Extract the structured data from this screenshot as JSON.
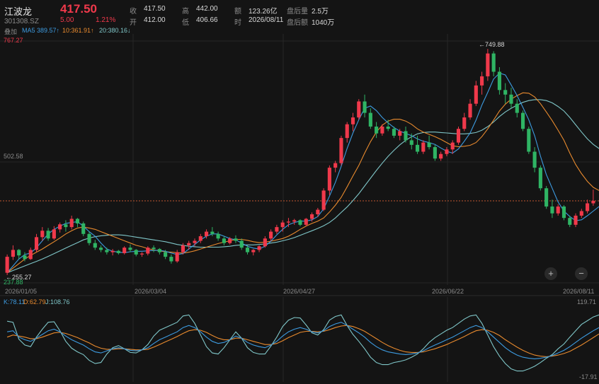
{
  "header": {
    "name": "江波龙",
    "code": "301308.SZ",
    "price": "417.50",
    "change": "5.00",
    "change_pct": "1.21%",
    "quote": [
      {
        "label": "收",
        "value": "417.50"
      },
      {
        "label": "开",
        "value": "412.00"
      },
      {
        "label": "高",
        "value": "442.00"
      },
      {
        "label": "低",
        "value": "406.66"
      },
      {
        "label": "额",
        "value": "123.26亿"
      },
      {
        "label": "时",
        "value": "2026/08/11"
      },
      {
        "label": "盘后量",
        "value": "2.5万"
      },
      {
        "label": "盘后额",
        "value": "1040万"
      }
    ]
  },
  "ma_legend": {
    "overlay": "叠加",
    "ma5": "MA5 389.57↑",
    "ma10": "10:361.91↑",
    "ma20": "20:380.16↓"
  },
  "kdj_legend": {
    "k": "K:78.11",
    "d": "D:62.79",
    "j": "J:108.76"
  },
  "colors": {
    "up": "#f0394b",
    "down": "#2fb464",
    "ma5": "#3d9be0",
    "ma10": "#e88a2e",
    "ma20": "#7fc6c8",
    "bg": "#141414"
  },
  "zoom": {
    "in": "+",
    "out": "−"
  },
  "chart_data": {
    "type": "candlestick",
    "price_axis": {
      "top_label": "767.27",
      "mid_label": "502.58",
      "bottom_label": "237.88",
      "range": [
        237.88,
        767.27
      ]
    },
    "x_ticks": [
      "2026/01/05",
      "2026/03/04",
      "2026/04/27",
      "2026/06/22",
      "2026/08/11"
    ],
    "annotations": {
      "high": "←749.88",
      "low": "←255.27"
    },
    "last_close": 417.5,
    "ohlc": [
      [
        260,
        300,
        255,
        295
      ],
      [
        295,
        320,
        288,
        310
      ],
      [
        310,
        312,
        290,
        298
      ],
      [
        298,
        305,
        285,
        290
      ],
      [
        290,
        315,
        288,
        310
      ],
      [
        310,
        345,
        305,
        338
      ],
      [
        338,
        360,
        330,
        352
      ],
      [
        352,
        358,
        330,
        335
      ],
      [
        335,
        362,
        332,
        355
      ],
      [
        355,
        370,
        348,
        366
      ],
      [
        366,
        375,
        350,
        360
      ],
      [
        360,
        385,
        355,
        378
      ],
      [
        378,
        380,
        360,
        368
      ],
      [
        368,
        372,
        340,
        345
      ],
      [
        345,
        350,
        320,
        325
      ],
      [
        325,
        332,
        310,
        315
      ],
      [
        315,
        320,
        305,
        310
      ],
      [
        310,
        315,
        300,
        305
      ],
      [
        305,
        312,
        298,
        308
      ],
      [
        308,
        310,
        300,
        303
      ],
      [
        303,
        318,
        300,
        315
      ],
      [
        315,
        322,
        305,
        310
      ],
      [
        310,
        312,
        296,
        300
      ],
      [
        300,
        305,
        295,
        302
      ],
      [
        302,
        318,
        298,
        315
      ],
      [
        315,
        320,
        305,
        312
      ],
      [
        312,
        314,
        300,
        305
      ],
      [
        305,
        310,
        290,
        295
      ],
      [
        295,
        300,
        280,
        285
      ],
      [
        285,
        310,
        282,
        305
      ],
      [
        305,
        325,
        300,
        320
      ],
      [
        320,
        330,
        310,
        325
      ],
      [
        325,
        335,
        318,
        330
      ],
      [
        330,
        345,
        325,
        340
      ],
      [
        340,
        355,
        335,
        350
      ],
      [
        350,
        360,
        340,
        345
      ],
      [
        345,
        350,
        330,
        335
      ],
      [
        335,
        340,
        320,
        325
      ],
      [
        325,
        338,
        322,
        335
      ],
      [
        335,
        342,
        325,
        330
      ],
      [
        330,
        335,
        310,
        315
      ],
      [
        315,
        320,
        300,
        305
      ],
      [
        305,
        312,
        298,
        310
      ],
      [
        310,
        320,
        305,
        318
      ],
      [
        318,
        340,
        315,
        335
      ],
      [
        335,
        355,
        330,
        350
      ],
      [
        350,
        365,
        345,
        360
      ],
      [
        360,
        375,
        350,
        370
      ],
      [
        370,
        380,
        360,
        372
      ],
      [
        372,
        378,
        365,
        375
      ],
      [
        375,
        377,
        362,
        365
      ],
      [
        365,
        380,
        362,
        378
      ],
      [
        378,
        392,
        372,
        388
      ],
      [
        388,
        402,
        382,
        398
      ],
      [
        398,
        445,
        395,
        440
      ],
      [
        440,
        495,
        430,
        490
      ],
      [
        490,
        505,
        480,
        500
      ],
      [
        500,
        560,
        495,
        555
      ],
      [
        555,
        590,
        545,
        585
      ],
      [
        585,
        610,
        570,
        600
      ],
      [
        600,
        640,
        595,
        635
      ],
      [
        635,
        650,
        600,
        610
      ],
      [
        610,
        620,
        575,
        580
      ],
      [
        580,
        590,
        555,
        565
      ],
      [
        565,
        585,
        560,
        580
      ],
      [
        580,
        595,
        570,
        575
      ],
      [
        575,
        580,
        555,
        560
      ],
      [
        560,
        575,
        550,
        570
      ],
      [
        570,
        580,
        545,
        550
      ],
      [
        550,
        565,
        530,
        540
      ],
      [
        540,
        560,
        520,
        525
      ],
      [
        525,
        550,
        520,
        545
      ],
      [
        545,
        560,
        530,
        535
      ],
      [
        535,
        540,
        505,
        510
      ],
      [
        510,
        525,
        505,
        520
      ],
      [
        520,
        535,
        515,
        530
      ],
      [
        530,
        550,
        520,
        545
      ],
      [
        545,
        580,
        540,
        575
      ],
      [
        575,
        610,
        570,
        600
      ],
      [
        600,
        640,
        595,
        630
      ],
      [
        630,
        680,
        625,
        670
      ],
      [
        670,
        700,
        650,
        690
      ],
      [
        690,
        750,
        680,
        740
      ],
      [
        740,
        745,
        690,
        700
      ],
      [
        700,
        710,
        650,
        660
      ],
      [
        660,
        675,
        630,
        650
      ],
      [
        650,
        665,
        620,
        630
      ],
      [
        630,
        640,
        600,
        610
      ],
      [
        610,
        615,
        570,
        575
      ],
      [
        575,
        580,
        520,
        525
      ],
      [
        525,
        535,
        480,
        490
      ],
      [
        490,
        495,
        440,
        445
      ],
      [
        445,
        450,
        400,
        405
      ],
      [
        405,
        420,
        380,
        390
      ],
      [
        390,
        410,
        385,
        405
      ],
      [
        405,
        408,
        375,
        380
      ],
      [
        380,
        385,
        360,
        365
      ],
      [
        365,
        390,
        360,
        385
      ],
      [
        385,
        400,
        380,
        395
      ],
      [
        395,
        420,
        390,
        412
      ],
      [
        412,
        442,
        406.66,
        417.5
      ]
    ],
    "ma5": [
      260,
      275,
      290,
      300,
      303,
      315,
      330,
      345,
      355,
      362,
      368,
      370,
      372,
      362,
      350,
      340,
      325,
      312,
      307,
      305,
      304,
      306,
      307,
      307,
      308,
      309,
      309,
      307,
      303,
      300,
      302,
      312,
      322,
      332,
      340,
      345,
      345,
      340,
      335,
      332,
      325,
      318,
      314,
      312,
      318,
      329,
      343,
      355,
      365,
      370,
      373,
      373,
      376,
      383,
      400,
      428,
      458,
      493,
      532,
      566,
      595,
      620,
      625,
      615,
      600,
      588,
      578,
      570,
      565,
      560,
      553,
      548,
      545,
      541,
      533,
      526,
      522,
      531,
      548,
      566,
      594,
      627,
      655,
      684,
      697,
      693,
      671,
      648,
      622,
      595,
      560,
      515,
      475,
      445,
      415,
      395,
      383,
      374,
      376,
      385,
      395,
      405
    ],
    "ma10": [
      260,
      270,
      280,
      290,
      298,
      305,
      312,
      320,
      328,
      336,
      345,
      352,
      358,
      360,
      358,
      355,
      350,
      345,
      340,
      335,
      330,
      325,
      320,
      317,
      313,
      310,
      308,
      306,
      305,
      304,
      303,
      305,
      308,
      312,
      316,
      320,
      324,
      327,
      330,
      333,
      333,
      331,
      328,
      326,
      327,
      329,
      332,
      335,
      340,
      347,
      355,
      362,
      368,
      373,
      380,
      393,
      408,
      425,
      448,
      472,
      495,
      522,
      547,
      568,
      583,
      592,
      596,
      596,
      592,
      585,
      575,
      568,
      563,
      558,
      552,
      545,
      538,
      536,
      537,
      539,
      545,
      558,
      575,
      594,
      614,
      629,
      640,
      648,
      654,
      653,
      645,
      630,
      612,
      593,
      572,
      550,
      522,
      497,
      477,
      460,
      447,
      440
    ],
    "ma20": [
      260,
      265,
      270,
      275,
      280,
      285,
      290,
      296,
      302,
      308,
      314,
      320,
      326,
      332,
      336,
      339,
      341,
      342,
      343,
      343,
      342,
      340,
      338,
      336,
      334,
      332,
      330,
      328,
      325,
      322,
      320,
      318,
      317,
      316,
      316,
      316,
      316,
      317,
      318,
      320,
      321,
      321,
      321,
      322,
      323,
      325,
      327,
      330,
      333,
      337,
      342,
      347,
      352,
      357,
      363,
      370,
      380,
      392,
      404,
      418,
      433,
      450,
      467,
      484,
      500,
      515,
      528,
      540,
      550,
      558,
      564,
      567,
      568,
      568,
      567,
      566,
      565,
      564,
      564,
      565,
      567,
      572,
      580,
      590,
      602,
      612,
      620,
      627,
      633,
      637,
      639,
      639,
      637,
      632,
      624,
      614,
      600,
      584,
      568,
      553,
      541,
      532
    ],
    "kdj": {
      "axis_top": "119.71",
      "axis_bottom": "-17.91",
      "range": [
        -17.91,
        119.71
      ],
      "k": [
        70,
        72,
        60,
        55,
        52,
        58,
        65,
        72,
        75,
        70,
        62,
        55,
        50,
        45,
        38,
        32,
        30,
        34,
        38,
        40,
        38,
        35,
        34,
        36,
        40,
        48,
        55,
        60,
        65,
        70,
        78,
        82,
        78,
        70,
        60,
        52,
        48,
        50,
        55,
        62,
        58,
        50,
        45,
        42,
        40,
        45,
        52,
        62,
        70,
        75,
        78,
        75,
        70,
        68,
        72,
        80,
        85,
        88,
        82,
        75,
        68,
        60,
        50,
        42,
        36,
        32,
        30,
        28,
        27,
        28,
        30,
        34,
        40,
        45,
        50,
        55,
        60,
        66,
        72,
        78,
        82,
        78,
        70,
        60,
        50,
        40,
        32,
        26,
        22,
        20,
        19,
        20,
        22,
        25,
        30,
        35,
        42,
        50,
        58,
        65,
        72,
        78
      ],
      "d": [
        60,
        64,
        62,
        60,
        57,
        57,
        60,
        64,
        68,
        69,
        67,
        63,
        59,
        54,
        49,
        43,
        39,
        37,
        37,
        38,
        38,
        37,
        36,
        36,
        37,
        41,
        46,
        51,
        56,
        61,
        67,
        72,
        74,
        73,
        69,
        63,
        58,
        55,
        55,
        58,
        58,
        55,
        52,
        49,
        46,
        46,
        48,
        53,
        59,
        64,
        69,
        71,
        71,
        70,
        71,
        74,
        78,
        81,
        82,
        80,
        76,
        71,
        64,
        57,
        50,
        44,
        39,
        35,
        32,
        31,
        31,
        32,
        35,
        38,
        42,
        46,
        51,
        56,
        61,
        67,
        72,
        74,
        73,
        69,
        63,
        55,
        48,
        41,
        35,
        30,
        26,
        24,
        23,
        24,
        26,
        29,
        33,
        39,
        45,
        52,
        59,
        66
      ],
      "j": [
        90,
        88,
        56,
        45,
        42,
        60,
        75,
        88,
        89,
        72,
        52,
        39,
        32,
        27,
        16,
        10,
        12,
        28,
        40,
        44,
        38,
        31,
        30,
        36,
        46,
        62,
        73,
        78,
        83,
        88,
        100,
        102,
        86,
        64,
        42,
        30,
        28,
        40,
        55,
        70,
        58,
        40,
        31,
        28,
        28,
        43,
        60,
        80,
        92,
        97,
        96,
        83,
        68,
        64,
        74,
        92,
        99,
        102,
        82,
        65,
        52,
        38,
        22,
        12,
        8,
        8,
        12,
        14,
        17,
        22,
        28,
        38,
        50,
        59,
        66,
        73,
        78,
        86,
        94,
        100,
        102,
        86,
        64,
        42,
        24,
        10,
        0,
        -4,
        -4,
        0,
        5,
        12,
        20,
        27,
        38,
        47,
        60,
        72,
        84,
        91,
        98,
        102
      ]
    }
  }
}
